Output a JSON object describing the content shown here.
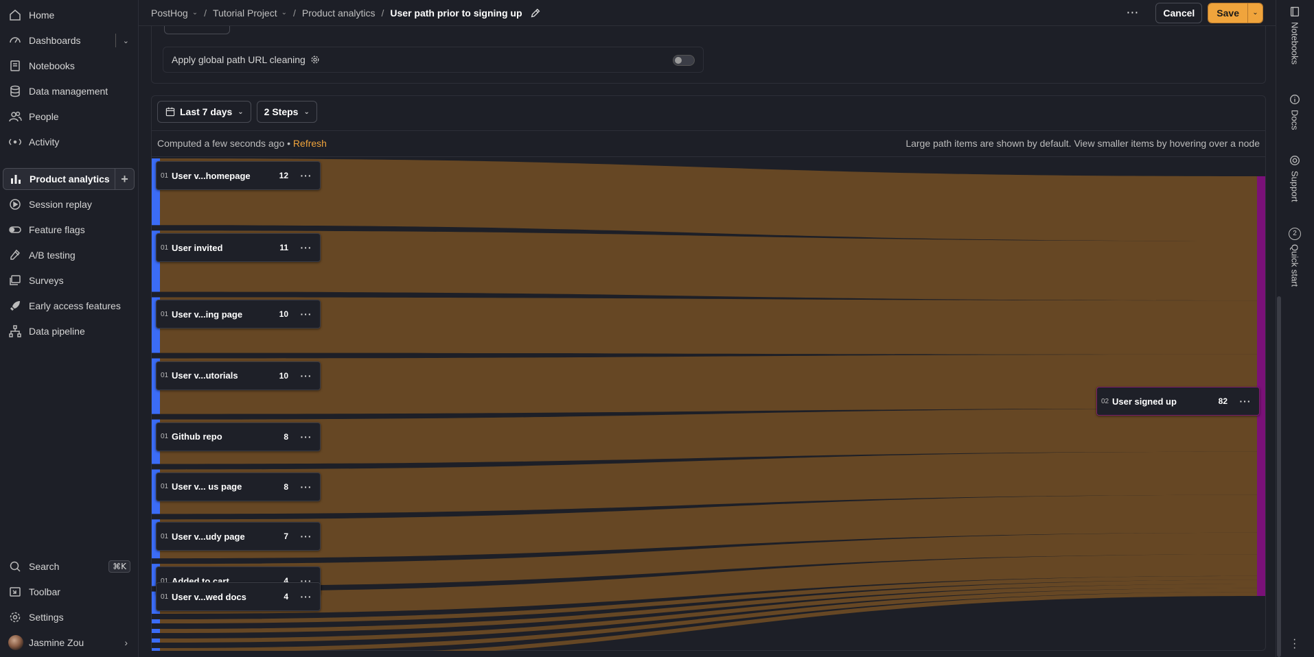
{
  "sidebar": {
    "items": [
      {
        "label": "Home",
        "icon": "home-icon"
      },
      {
        "label": "Dashboards",
        "icon": "dashboard-icon"
      },
      {
        "label": "Notebooks",
        "icon": "notebook-icon"
      },
      {
        "label": "Data management",
        "icon": "database-icon"
      },
      {
        "label": "People",
        "icon": "people-icon"
      },
      {
        "label": "Activity",
        "icon": "activity-icon"
      },
      {
        "label": "Product analytics",
        "icon": "bar-chart-icon",
        "active": true
      },
      {
        "label": "Session replay",
        "icon": "replay-icon"
      },
      {
        "label": "Feature flags",
        "icon": "toggle-icon"
      },
      {
        "label": "A/B testing",
        "icon": "flask-icon"
      },
      {
        "label": "Surveys",
        "icon": "survey-icon"
      },
      {
        "label": "Early access features",
        "icon": "rocket-icon"
      },
      {
        "label": "Data pipeline",
        "icon": "pipeline-icon"
      }
    ],
    "bottom": {
      "search": "Search",
      "search_shortcut": "⌘K",
      "toolbar": "Toolbar",
      "settings": "Settings",
      "user": "Jasmine Zou"
    }
  },
  "breadcrumb": {
    "org": "PostHog",
    "project": "Tutorial Project",
    "section": "Product analytics",
    "current": "User path prior to signing up"
  },
  "actions": {
    "cancel": "Cancel",
    "save": "Save"
  },
  "right_rail": [
    "Notebooks",
    "Docs",
    "Support",
    "Quick start"
  ],
  "quick_start_badge": "2",
  "settings_panel": {
    "clean_label": "Apply global path URL cleaning",
    "clean_enabled": false
  },
  "filters": {
    "date_range": "Last 7 days",
    "steps": "2 Steps"
  },
  "status": {
    "computed": "Computed a few seconds ago",
    "bullet": "•",
    "refresh": "Refresh",
    "hint": "Large path items are shown by default. View smaller items by hovering over a node"
  },
  "chart_data": {
    "type": "sankey",
    "source_nodes": [
      {
        "step": "01",
        "name": "User v...homepage",
        "count": 12
      },
      {
        "step": "01",
        "name": "User invited",
        "count": 11
      },
      {
        "step": "01",
        "name": "User v...ing page",
        "count": 10
      },
      {
        "step": "01",
        "name": "User v...utorials",
        "count": 10
      },
      {
        "step": "01",
        "name": "Github repo",
        "count": 8
      },
      {
        "step": "01",
        "name": "User v... us page",
        "count": 8
      },
      {
        "step": "01",
        "name": "User v...udy page",
        "count": 7
      },
      {
        "step": "01",
        "name": "Added to cart",
        "count": 4
      },
      {
        "step": "01",
        "name": "User v...wed docs",
        "count": 4
      }
    ],
    "target_node": {
      "step": "02",
      "name": "User signed up",
      "count": 82
    },
    "colors": {
      "source_bar": "#3b6cf6",
      "target_bar": "#7a1178",
      "link": "#6a4a24"
    }
  }
}
